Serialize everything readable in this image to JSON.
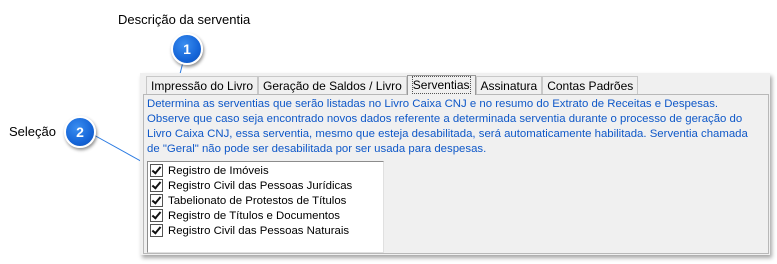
{
  "callouts": [
    {
      "number": "1",
      "label": "Descrição da serventia"
    },
    {
      "number": "2",
      "label": "Seleção"
    }
  ],
  "tabs": [
    {
      "label": "Impressão do Livro",
      "active": false
    },
    {
      "label": "Geração de Saldos / Livro",
      "active": false
    },
    {
      "label": "Serventias",
      "active": true
    },
    {
      "label": "Assinatura",
      "active": false
    },
    {
      "label": "Contas Padrões",
      "active": false
    }
  ],
  "description": "Determina as serventias que serão listadas no Livro Caixa CNJ e no resumo do Extrato de Receitas e Despesas. Observe que caso seja encontrado novos dados referente a determinada serventia durante o processo de geração do Livro Caixa CNJ, essa serventia, mesmo que esteja desabilitada, será automaticamente habilitada. Serventia chamada de \"Geral\" não pode ser desabilitada por ser usada para despesas.",
  "serventias": [
    {
      "label": "Registro de Imóveis",
      "checked": true
    },
    {
      "label": "Registro Civil das Pessoas Jurídicas",
      "checked": true
    },
    {
      "label": "Tabelionato de Protestos de Títulos",
      "checked": true
    },
    {
      "label": "Registro de Títulos e Documentos",
      "checked": true
    },
    {
      "label": "Registro Civil das Pessoas Naturais",
      "checked": true
    }
  ],
  "colors": {
    "description_text": "#0f58c8",
    "badge": "#1565d8"
  }
}
